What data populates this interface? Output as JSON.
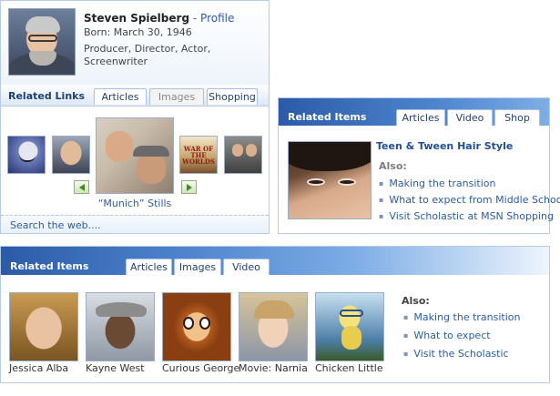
{
  "profile": {
    "name": "Steven Spielberg",
    "separator": "-",
    "profile_link": "Profile",
    "born": "Born: March 30, 1946",
    "roles": "Producer, Director, Actor, Screenwriter",
    "photo_icon": "portrait-photo"
  },
  "related_links": {
    "title": "Related Links",
    "tabs": [
      {
        "label": "Articles",
        "active": true
      },
      {
        "label": "Images",
        "active": false
      },
      {
        "label": "Shopping",
        "active": true
      }
    ],
    "carousel_caption": "“Munich” Stills",
    "war_poster_text": "WAR OF THE WORLDS",
    "prev_icon": "arrow-left-icon",
    "next_icon": "arrow-right-icon",
    "search_link": "Search the web...."
  },
  "related_items_small": {
    "title": "Related Items",
    "tabs": [
      {
        "label": "Articles",
        "active": true
      },
      {
        "label": "Video",
        "active": false
      },
      {
        "label": "Shop",
        "active": false
      }
    ],
    "heading": "Teen & Tween Hair Style",
    "also_label": "Also:",
    "links": [
      "Making the transition",
      "What to expect from Middle School",
      "Visit Scholastic at MSN Shopping"
    ]
  },
  "related_items_wide": {
    "title": "Related Items",
    "tabs": [
      {
        "label": "Articles",
        "active": false
      },
      {
        "label": "Images",
        "active": true
      },
      {
        "label": "Video",
        "active": false
      }
    ],
    "cards": [
      {
        "label": "Jessica Alba"
      },
      {
        "label": "Kayne West"
      },
      {
        "label": "Curious George"
      },
      {
        "label": "Movie: Narnia"
      },
      {
        "label": "Chicken Little"
      }
    ],
    "also_label": "Also:",
    "links": [
      "Making the transition",
      "What to expect",
      "Visit the Scholastic"
    ]
  },
  "colors": {
    "link": "#2a5ba8",
    "header_gradient_start": "#2b5ba8",
    "border": "#b7cbe6"
  }
}
